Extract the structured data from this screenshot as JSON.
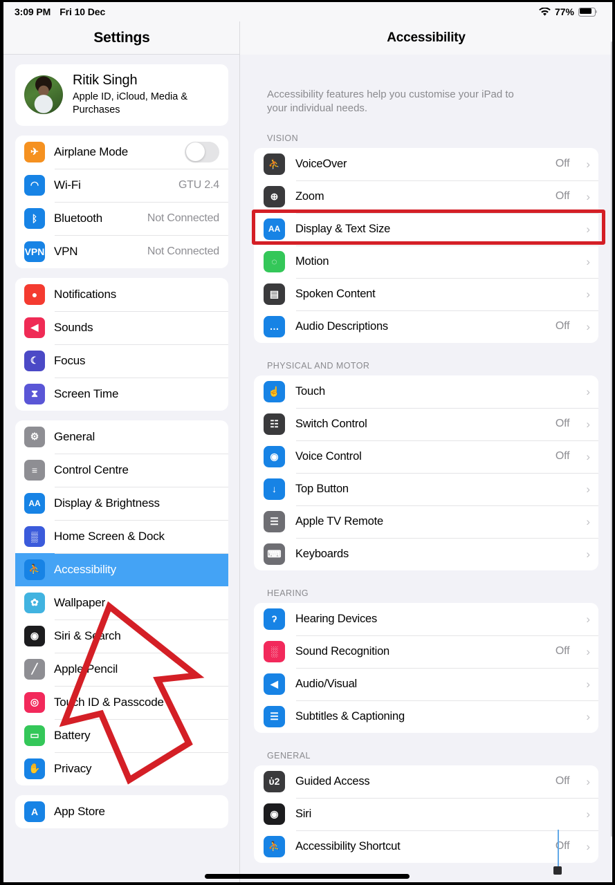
{
  "statusbar": {
    "time": "3:09 PM",
    "date": "Fri 10 Dec",
    "battery_percent": "77%",
    "wifi_icon": "wifi-icon",
    "battery_icon": "battery-icon"
  },
  "sidebar": {
    "title": "Settings",
    "account": {
      "name": "Ritik Singh",
      "subtitle": "Apple ID, iCloud, Media & Purchases",
      "avatar": "profile-photo"
    },
    "groups": [
      {
        "items": [
          {
            "label": "Airplane Mode",
            "icon": "airplane-icon",
            "icon_color": "#f59120",
            "control": "toggle",
            "toggle_on": false
          },
          {
            "label": "Wi-Fi",
            "icon": "wifi-icon",
            "icon_color": "#1783e5",
            "value": "GTU 2.4"
          },
          {
            "label": "Bluetooth",
            "icon": "bluetooth-icon",
            "icon_color": "#1783e5",
            "value": "Not Connected"
          },
          {
            "label": "VPN",
            "icon": "vpn-icon",
            "icon_color": "#1783e5",
            "value": "Not Connected"
          }
        ]
      },
      {
        "items": [
          {
            "label": "Notifications",
            "icon": "notifications-bell-icon",
            "icon_color": "#f43b30"
          },
          {
            "label": "Sounds",
            "icon": "speaker-icon",
            "icon_color": "#ef2b55"
          },
          {
            "label": "Focus",
            "icon": "moon-icon",
            "icon_color": "#4b49c6"
          },
          {
            "label": "Screen Time",
            "icon": "hourglass-icon",
            "icon_color": "#5a56d6"
          }
        ]
      },
      {
        "items": [
          {
            "label": "General",
            "icon": "gear-icon",
            "icon_color": "#8e8e93"
          },
          {
            "label": "Control Centre",
            "icon": "sliders-icon",
            "icon_color": "#8e8e93"
          },
          {
            "label": "Display & Brightness",
            "icon": "aa-text-icon",
            "icon_color": "#1783e5",
            "icon_text": "AA"
          },
          {
            "label": "Home Screen & Dock",
            "icon": "home-grid-icon",
            "icon_color": "#3b5bdb"
          },
          {
            "label": "Accessibility",
            "icon": "accessibility-icon",
            "icon_color": "#1783e5",
            "selected": true
          },
          {
            "label": "Wallpaper",
            "icon": "wallpaper-flower-icon",
            "icon_color": "#41b3e0"
          },
          {
            "label": "Siri & Search",
            "icon": "siri-orb-icon",
            "icon_color": "#1c1c1e"
          },
          {
            "label": "Apple Pencil",
            "icon": "pencil-icon",
            "icon_color": "#8e8e93"
          },
          {
            "label": "Touch ID & Passcode",
            "icon": "fingerprint-icon",
            "icon_color": "#f2295b"
          },
          {
            "label": "Battery",
            "icon": "battery-icon",
            "icon_color": "#34c759"
          },
          {
            "label": "Privacy",
            "icon": "hand-icon",
            "icon_color": "#1783e5"
          }
        ]
      },
      {
        "items": [
          {
            "label": "App Store",
            "icon": "app-store-icon",
            "icon_color": "#1783e5"
          }
        ]
      }
    ]
  },
  "detail": {
    "title": "Accessibility",
    "intro": "Accessibility features help you customise your iPad to your individual needs.",
    "sections": [
      {
        "header": "VISION",
        "rows": [
          {
            "label": "VoiceOver",
            "icon": "voiceover-icon",
            "icon_color": "#3a3a3c",
            "value": "Off"
          },
          {
            "label": "Zoom",
            "icon": "zoom-icon",
            "icon_color": "#3a3a3c",
            "value": "Off"
          },
          {
            "label": "Display & Text Size",
            "icon": "aa-text-icon",
            "icon_color": "#1783e5",
            "icon_text": "AA",
            "highlighted": true
          },
          {
            "label": "Motion",
            "icon": "motion-icon",
            "icon_color": "#34c759"
          },
          {
            "label": "Spoken Content",
            "icon": "spoken-content-icon",
            "icon_color": "#3a3a3c"
          },
          {
            "label": "Audio Descriptions",
            "icon": "audio-descriptions-icon",
            "icon_color": "#1783e5",
            "value": "Off"
          }
        ]
      },
      {
        "header": "PHYSICAL AND MOTOR",
        "rows": [
          {
            "label": "Touch",
            "icon": "touch-hand-icon",
            "icon_color": "#1783e5"
          },
          {
            "label": "Switch Control",
            "icon": "switch-control-icon",
            "icon_color": "#3a3a3c",
            "value": "Off"
          },
          {
            "label": "Voice Control",
            "icon": "voice-control-icon",
            "icon_color": "#1783e5",
            "value": "Off"
          },
          {
            "label": "Top Button",
            "icon": "top-button-icon",
            "icon_color": "#1783e5"
          },
          {
            "label": "Apple TV Remote",
            "icon": "apple-tv-remote-icon",
            "icon_color": "#6e6e73"
          },
          {
            "label": "Keyboards",
            "icon": "keyboard-icon",
            "icon_color": "#6e6e73"
          }
        ]
      },
      {
        "header": "HEARING",
        "rows": [
          {
            "label": "Hearing Devices",
            "icon": "ear-icon",
            "icon_color": "#1783e5"
          },
          {
            "label": "Sound Recognition",
            "icon": "sound-recognition-icon",
            "icon_color": "#f2295b",
            "value": "Off"
          },
          {
            "label": "Audio/Visual",
            "icon": "audio-visual-icon",
            "icon_color": "#1783e5"
          },
          {
            "label": "Subtitles & Captioning",
            "icon": "subtitles-icon",
            "icon_color": "#1783e5"
          }
        ]
      },
      {
        "header": "GENERAL",
        "rows": [
          {
            "label": "Guided Access",
            "icon": "lock-icon",
            "icon_color": "#3a3a3c",
            "value": "Off"
          },
          {
            "label": "Siri",
            "icon": "siri-orb-icon",
            "icon_color": "#1c1c1e"
          },
          {
            "label": "Accessibility Shortcut",
            "icon": "accessibility-icon",
            "icon_color": "#1783e5",
            "value": "Off"
          }
        ]
      }
    ]
  },
  "annotations": {
    "highlight_box_color": "#d41f26",
    "arrow_color": "#d41f26",
    "arrow_target": "Accessibility",
    "highlight_target": "Display & Text Size"
  }
}
